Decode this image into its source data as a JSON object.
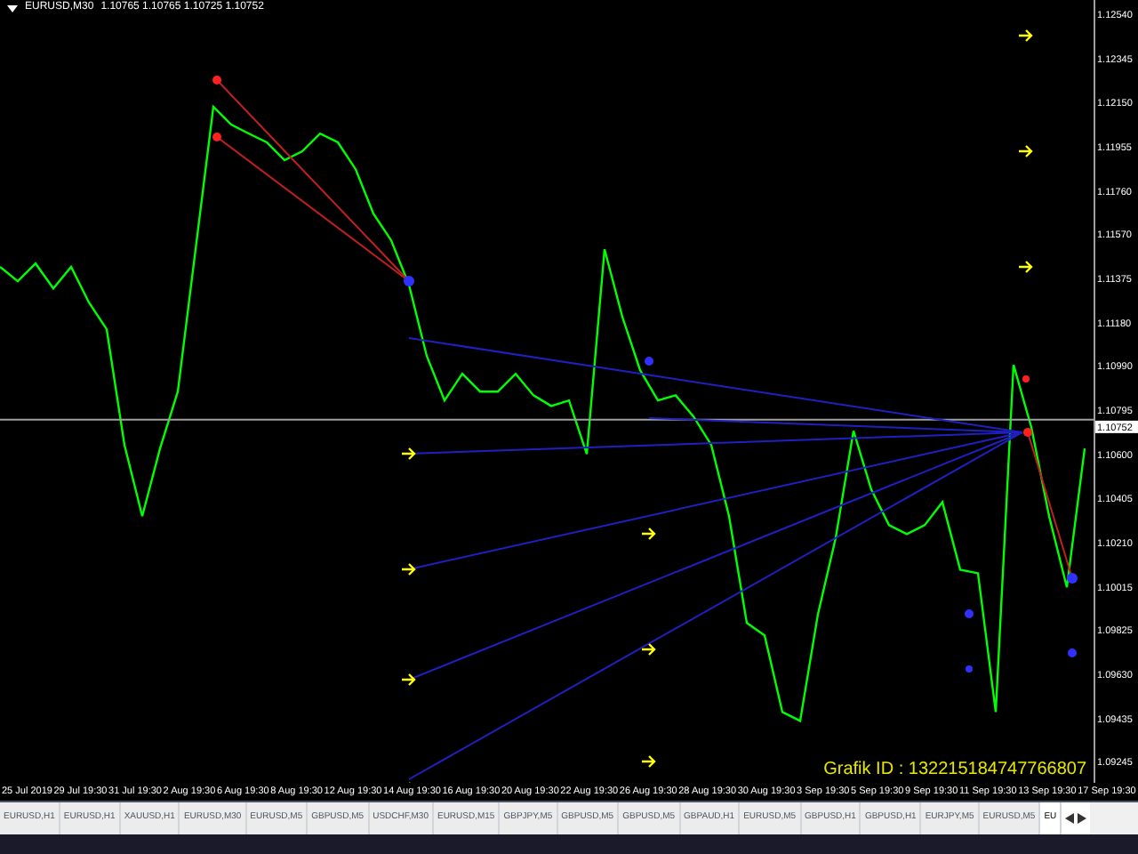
{
  "chart": {
    "header": {
      "symbol": "EURUSD,M30",
      "prices": "1.10765 1.10765 1.10725 1.10752"
    },
    "chart_data": {
      "type": "line",
      "ylim": [
        1.09151,
        1.12603
      ],
      "yticks": [
        {
          "value": 1.1254,
          "label": "1.12540"
        },
        {
          "value": 1.12345,
          "label": "1.12345"
        },
        {
          "value": 1.1215,
          "label": "1.12150"
        },
        {
          "value": 1.11955,
          "label": "1.11955"
        },
        {
          "value": 1.1176,
          "label": "1.11760"
        },
        {
          "value": 1.1157,
          "label": "1.11570"
        },
        {
          "value": 1.11375,
          "label": "1.11375"
        },
        {
          "value": 1.1118,
          "label": "1.11180"
        },
        {
          "value": 1.1099,
          "label": "1.10990"
        },
        {
          "value": 1.10795,
          "label": "1.10795"
        },
        {
          "value": 1.106,
          "label": "1.10600"
        },
        {
          "value": 1.10405,
          "label": "1.10405"
        },
        {
          "value": 1.1021,
          "label": "1.10210"
        },
        {
          "value": 1.10015,
          "label": "1.10015"
        },
        {
          "value": 1.09825,
          "label": "1.09825"
        },
        {
          "value": 1.0963,
          "label": "1.09630"
        },
        {
          "value": 1.09435,
          "label": "1.09435"
        },
        {
          "value": 1.09245,
          "label": "1.09245"
        }
      ],
      "series": [
        {
          "color": "#00ff00",
          "values": [
            1.11426,
            1.11363,
            1.11441,
            1.11331,
            1.11426,
            1.11269,
            1.11151,
            1.10641,
            1.10327,
            1.10625,
            1.10876,
            1.11504,
            1.12132,
            1.12054,
            1.12014,
            1.11975,
            1.11897,
            1.11936,
            1.12014,
            1.11975,
            1.11857,
            1.11661,
            1.11543,
            1.11347,
            1.11033,
            1.10837,
            1.10955,
            1.10876,
            1.10876,
            1.10955,
            1.1086,
            1.10813,
            1.10837,
            1.10601,
            1.11504,
            1.11206,
            1.1097,
            1.10837,
            1.1086,
            1.10766,
            1.10641,
            1.10327,
            1.09856,
            1.09801,
            1.09463,
            1.09424,
            1.09895,
            1.10232,
            1.10703,
            1.10444,
            1.10287,
            1.10248,
            1.10287,
            1.10389,
            1.10091,
            1.10075,
            1.09463,
            1.10994,
            1.10719,
            1.10327,
            1.10013,
            1.10625
          ]
        }
      ]
    },
    "current_price": "1.10752",
    "annotation": "Grafik ID : 132215184747766807",
    "time_axis": [
      "25 Jul 2019",
      "29 Jul 19:30",
      "31 Jul 19:30",
      "2 Aug 19:30",
      "6 Aug 19:30",
      "8 Aug 19:30",
      "12 Aug 19:30",
      "14 Aug 19:30",
      "16 Aug 19:30",
      "20 Aug 19:30",
      "22 Aug 19:30",
      "26 Aug 19:30",
      "28 Aug 19:30",
      "30 Aug 19:30",
      "3 Sep 19:30",
      "5 Sep 19:30",
      "9 Sep 19:30",
      "11 Sep 19:30",
      "13 Sep 19:30",
      "17 Sep 19:30"
    ]
  },
  "tabs": [
    {
      "label": "EURUSD,H1",
      "selected": false
    },
    {
      "label": "EURUSD,H1",
      "selected": false
    },
    {
      "label": "XAUUSD,H1",
      "selected": false
    },
    {
      "label": "EURUSD,M30",
      "selected": false
    },
    {
      "label": "EURUSD,M5",
      "selected": false
    },
    {
      "label": "GBPUSD,M5",
      "selected": false
    },
    {
      "label": "USDCHF,M30",
      "selected": false
    },
    {
      "label": "EURUSD,M15",
      "selected": false
    },
    {
      "label": "GBPJPY,M5",
      "selected": false
    },
    {
      "label": "GBPUSD,M5",
      "selected": false
    },
    {
      "label": "GBPUSD,M5",
      "selected": false
    },
    {
      "label": "GBPAUD,H1",
      "selected": false
    },
    {
      "label": "EURUSD,M5",
      "selected": false
    },
    {
      "label": "GBPUSD,H1",
      "selected": false
    },
    {
      "label": "GBPUSD,H1",
      "selected": false
    },
    {
      "label": "EURJPY,M5",
      "selected": false
    },
    {
      "label": "EURUSD,M5",
      "selected": false
    },
    {
      "label": "EU",
      "selected": true
    }
  ]
}
